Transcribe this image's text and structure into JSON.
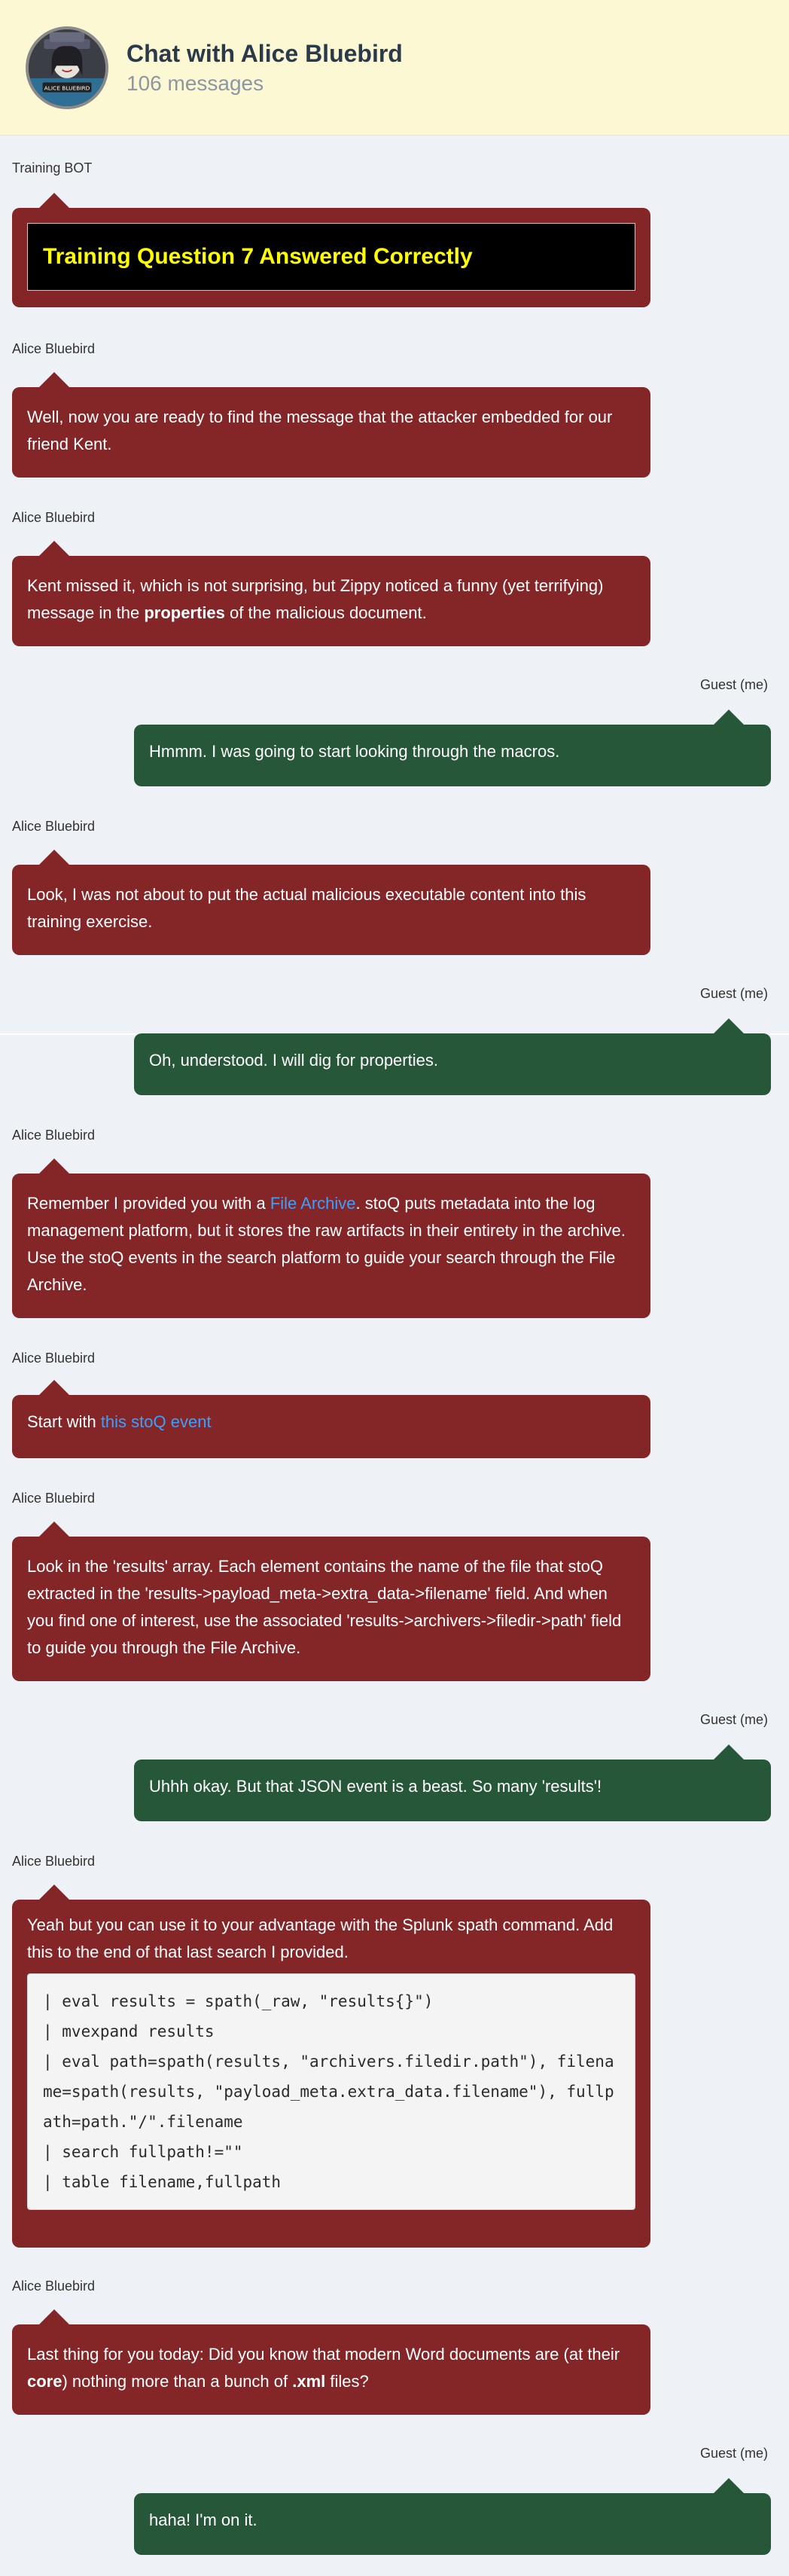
{
  "header": {
    "title": "Chat with Alice Bluebird",
    "subtitle": "106 messages",
    "avatar_caption": "ALICE BLUEBIRD"
  },
  "messages": [
    {
      "sender": "Training BOT",
      "training_text": "Training Question 7 Answered Correctly"
    },
    {
      "sender": "Alice Bluebird",
      "text": "Well, now you are ready to find the message that the attacker embedded for our friend Kent."
    },
    {
      "sender": "Alice Bluebird",
      "text_a": "Kent missed it, which is not surprising, but Zippy noticed a funny (yet terrifying) message in the ",
      "bold": "properties",
      "text_b": " of the malicious document."
    },
    {
      "sender": "Guest (me)",
      "text": "Hmmm. I was going to start looking through the macros."
    },
    {
      "sender": "Alice Bluebird",
      "text": "Look, I was not about to put the actual malicious executable content into this training exercise."
    },
    {
      "sender": "Guest (me)",
      "text": "Oh, understood. I will dig for properties."
    },
    {
      "sender": "Alice Bluebird",
      "text_a": "Remember I provided you with a ",
      "link": "File Archive",
      "text_b": ". stoQ puts metadata into the log management platform, but it stores the raw artifacts in their entirety in the archive. Use the stoQ events in the search platform to guide your search through the File Archive."
    },
    {
      "sender": "Alice Bluebird",
      "text_a": "Start with ",
      "link": "this stoQ event"
    },
    {
      "sender": "Alice Bluebird",
      "text": "Look in the 'results' array. Each element contains the name of the file that stoQ extracted in the 'results->payload_meta->extra_data->filename' field. And when you find one of interest, use the associated 'results->archivers->filedir->path' field to guide you through the File Archive."
    },
    {
      "sender": "Guest (me)",
      "text": "Uhhh okay. But that JSON event is a beast. So many 'results'!"
    },
    {
      "sender": "Alice Bluebird",
      "text": "Yeah but you can use it to your advantage with the Splunk spath command. Add this to the end of that last search I provided.",
      "code": "| eval results = spath(_raw, \"results{}\")\n| mvexpand results\n| eval path=spath(results, \"archivers.filedir.path\"), filename=spath(results, \"payload_meta.extra_data.filename\"), fullpath=path.\"/\".filename\n| search fullpath!=\"\"\n| table filename,fullpath"
    },
    {
      "sender": "Alice Bluebird",
      "text_a": "Last thing for you today: Did you know that modern Word documents are (at their ",
      "bold_a": "core",
      "text_b": ") nothing more than a bunch of ",
      "bold_b": ".xml",
      "text_c": " files?"
    },
    {
      "sender": "Guest (me)",
      "text": "haha! I'm on it."
    }
  ]
}
